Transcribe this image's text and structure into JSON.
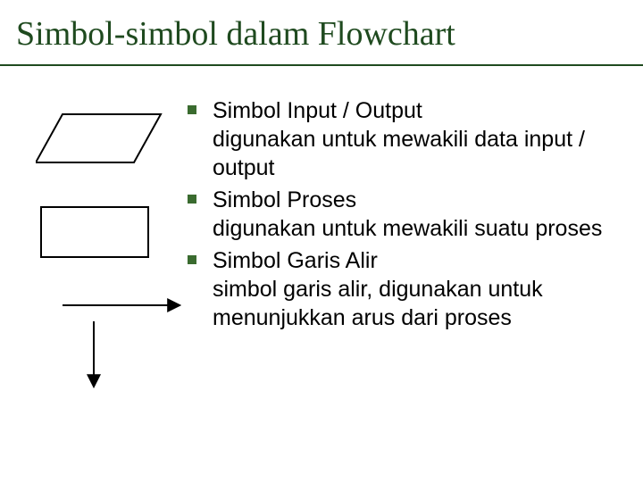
{
  "title": "Simbol-simbol dalam Flowchart",
  "items": [
    {
      "title": "Simbol Input / Output",
      "desc": "digunakan untuk mewakili data input / output"
    },
    {
      "title": "Simbol Proses",
      "desc": "digunakan untuk mewakili suatu proses"
    },
    {
      "title": "Simbol Garis Alir",
      "desc": "simbol garis alir, digunakan untuk menunjukkan arus dari proses"
    }
  ]
}
